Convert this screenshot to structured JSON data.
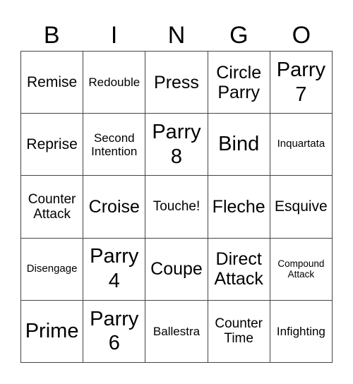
{
  "header": {
    "letters": [
      "B",
      "I",
      "N",
      "G",
      "O"
    ]
  },
  "grid": {
    "rows": [
      [
        {
          "text": "Remise",
          "size": "s-m"
        },
        {
          "text": "Redouble",
          "size": "s-s"
        },
        {
          "text": "Press",
          "size": "s-l"
        },
        {
          "text": "Circle Parry",
          "size": "s-l"
        },
        {
          "text": "Parry 7",
          "size": "s-xl"
        }
      ],
      [
        {
          "text": "Reprise",
          "size": "s-m"
        },
        {
          "text": "Second Intention",
          "size": "s-s"
        },
        {
          "text": "Parry 8",
          "size": "s-xl"
        },
        {
          "text": "Bind",
          "size": "s-xl"
        },
        {
          "text": "Inquartata",
          "size": "s-xs"
        }
      ],
      [
        {
          "text": "Counter Attack",
          "size": "s-ms"
        },
        {
          "text": "Croise",
          "size": "s-l"
        },
        {
          "text": "Touche!",
          "size": "s-ms"
        },
        {
          "text": "Fleche",
          "size": "s-l"
        },
        {
          "text": "Esquive",
          "size": "s-m"
        }
      ],
      [
        {
          "text": "Disengage",
          "size": "s-xs"
        },
        {
          "text": "Parry 4",
          "size": "s-xl"
        },
        {
          "text": "Coupe",
          "size": "s-l"
        },
        {
          "text": "Direct Attack",
          "size": "s-l"
        },
        {
          "text": "Compound Attack",
          "size": "s-xxs"
        }
      ],
      [
        {
          "text": "Prime",
          "size": "s-xl"
        },
        {
          "text": "Parry 6",
          "size": "s-xl"
        },
        {
          "text": "Ballestra",
          "size": "s-s"
        },
        {
          "text": "Counter Time",
          "size": "s-ms"
        },
        {
          "text": "Infighting",
          "size": "s-s"
        }
      ]
    ]
  }
}
